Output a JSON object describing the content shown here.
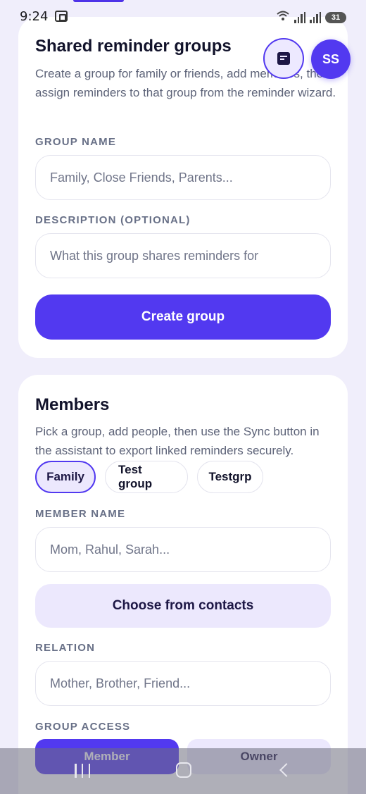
{
  "status_bar": {
    "time": "9:24",
    "battery": "31"
  },
  "header": {
    "avatar_initials": "SS"
  },
  "groups_card": {
    "title": "Shared reminder groups",
    "description": "Create a group for family or friends, add members, then assign reminders to that group from the reminder wizard.",
    "group_name_label": "GROUP NAME",
    "group_name_placeholder": "Family, Close Friends, Parents...",
    "description_label": "DESCRIPTION (OPTIONAL)",
    "description_placeholder": "What this group shares reminders for",
    "create_button": "Create group"
  },
  "members_card": {
    "title": "Members",
    "description": "Pick a group, add people, then use the Sync button in the assistant to export linked reminders securely.",
    "groups": [
      {
        "label": "Family",
        "selected": true
      },
      {
        "label": "Test group",
        "selected": false
      },
      {
        "label": "Testgrp",
        "selected": false
      }
    ],
    "member_name_label": "MEMBER NAME",
    "member_name_placeholder": "Mom, Rahul, Sarah...",
    "contacts_button": "Choose from contacts",
    "relation_label": "RELATION",
    "relation_placeholder": "Mother, Brother, Friend...",
    "access_label": "GROUP ACCESS",
    "access_options": [
      "Member",
      "Owner"
    ],
    "access_selected": "Member"
  },
  "colors": {
    "accent": "#5239f0",
    "accent_light": "#ece8fd",
    "background": "#f0eefb"
  },
  "icons": [
    "notes-icon",
    "recent-apps-icon",
    "home-icon",
    "back-icon"
  ]
}
